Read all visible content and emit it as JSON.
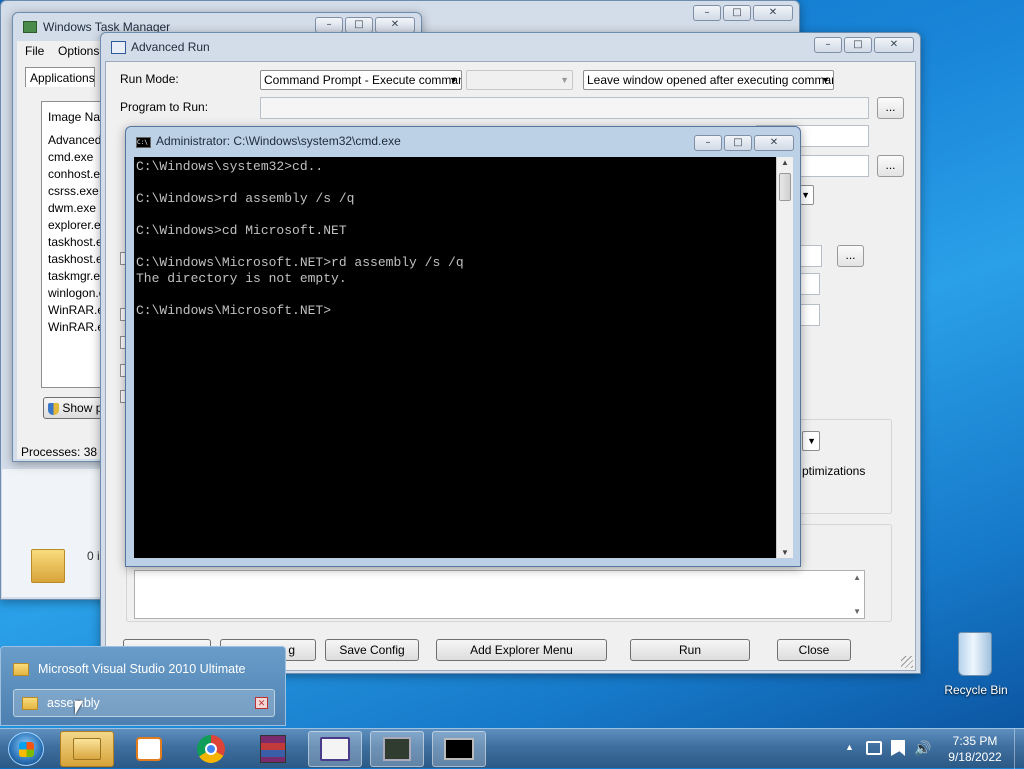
{
  "task_manager": {
    "title": "Windows Task Manager",
    "menu": [
      "File",
      "Options"
    ],
    "tab_applications": "Applications",
    "column": "Image Nam",
    "processes": [
      "AdvancedR",
      "cmd.exe",
      "conhost.ex",
      "csrss.exe",
      "dwm.exe",
      "explorer.ex",
      "taskhost.ex",
      "taskhost.ex",
      "taskmgr.ex",
      "winlogon.e",
      "WinRAR.ex",
      "WinRAR.exe"
    ],
    "show_button": "Show p",
    "status": "Processes: 38"
  },
  "explorer_fragment": {
    "count_text": "0 i"
  },
  "advanced_run": {
    "title": "Advanced Run",
    "run_mode_label": "Run Mode:",
    "run_mode_value": "Command Prompt - Execute command",
    "window_mode_value": "Leave window opened after executing command",
    "program_label": "Program to Run:",
    "ellipsis": "...",
    "optimizations_text": "ptimizations",
    "buttons": {
      "partial": "g",
      "save_config": "Save Config",
      "add_explorer_menu": "Add Explorer Menu",
      "run": "Run",
      "close": "Close"
    }
  },
  "cmd": {
    "title": "Administrator: C:\\Windows\\system32\\cmd.exe",
    "lines": [
      "C:\\Windows\\system32>cd..",
      "",
      "C:\\Windows>rd assembly /s /q",
      "",
      "C:\\Windows>cd Microsoft.NET",
      "",
      "C:\\Windows\\Microsoft.NET>rd assembly /s /q",
      "The directory is not empty.",
      "",
      "C:\\Windows\\Microsoft.NET>"
    ]
  },
  "flyout": {
    "items": [
      "Microsoft Visual Studio 2010 Ultimate",
      "assembly"
    ]
  },
  "desktop": {
    "recycle_bin": "Recycle Bin"
  },
  "tray": {
    "time": "7:35 PM",
    "date": "9/18/2022"
  },
  "caption": {
    "minimize": "–",
    "maximize": "□",
    "close": "✕"
  }
}
